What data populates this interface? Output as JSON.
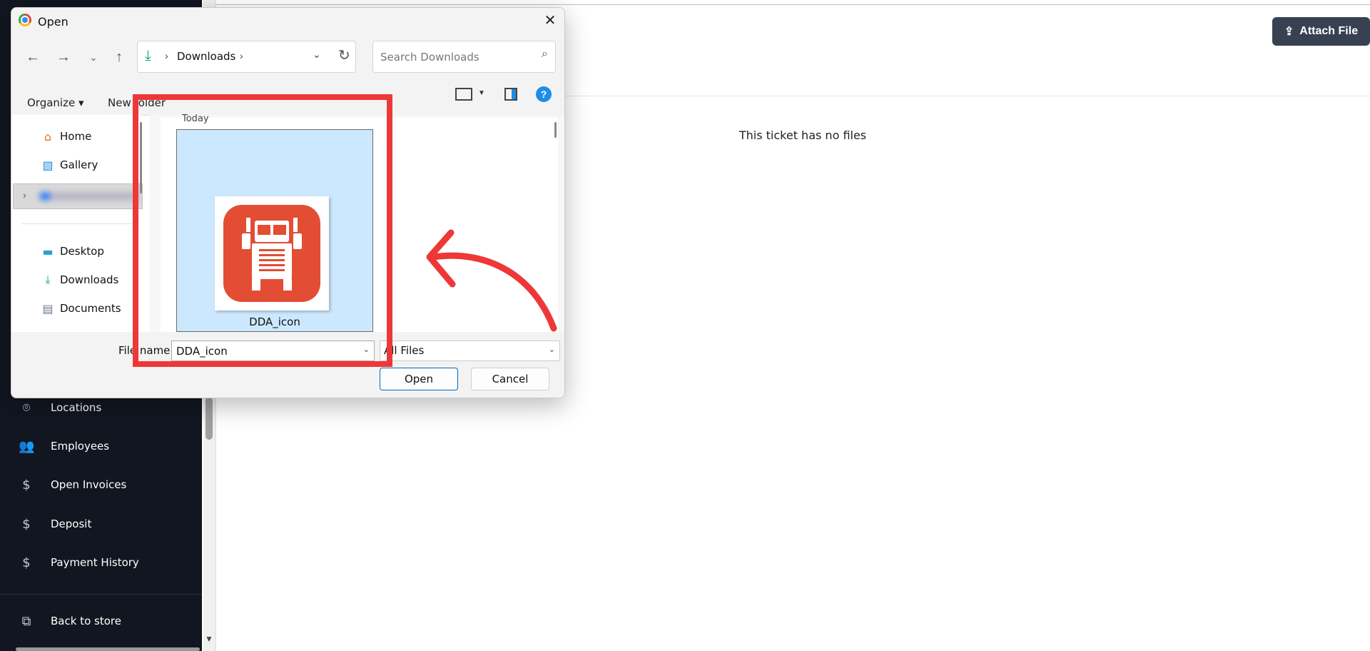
{
  "sidebar": {
    "items": [
      {
        "label": "Locations",
        "icon": "map-pin-icon"
      },
      {
        "label": "Employees",
        "icon": "users-icon"
      },
      {
        "label": "Open Invoices",
        "icon": "dollar-icon"
      },
      {
        "label": "Deposit",
        "icon": "dollar-icon"
      },
      {
        "label": "Payment History",
        "icon": "dollar-icon"
      },
      {
        "label": "Back to store",
        "icon": "external-link-icon"
      }
    ]
  },
  "main": {
    "attach_label": "Attach File",
    "empty_message": "This ticket has no files"
  },
  "dialog": {
    "title": "Open",
    "address": {
      "location": "Downloads"
    },
    "search_placeholder": "Search Downloads",
    "commands": {
      "organize": "Organize",
      "new_folder": "New folder"
    },
    "nav_items": [
      {
        "label": "Home",
        "icon": "home-icon"
      },
      {
        "label": "Gallery",
        "icon": "gallery-icon"
      },
      {
        "label": "Desktop",
        "icon": "desktop-icon"
      },
      {
        "label": "Downloads",
        "icon": "download-icon"
      },
      {
        "label": "Documents",
        "icon": "documents-icon"
      }
    ],
    "group_label": "Today",
    "files": [
      {
        "name": "DDA_icon",
        "selected": true
      }
    ],
    "file_name_label": "File name:",
    "file_name_value": "DDA_icon",
    "file_type": "All Files",
    "open_label": "Open",
    "cancel_label": "Cancel"
  },
  "colors": {
    "sidebar_bg": "#121621",
    "annotation_red": "#ee3838",
    "selection_blue": "#cce8ff",
    "app_icon_red": "#e34d34"
  }
}
